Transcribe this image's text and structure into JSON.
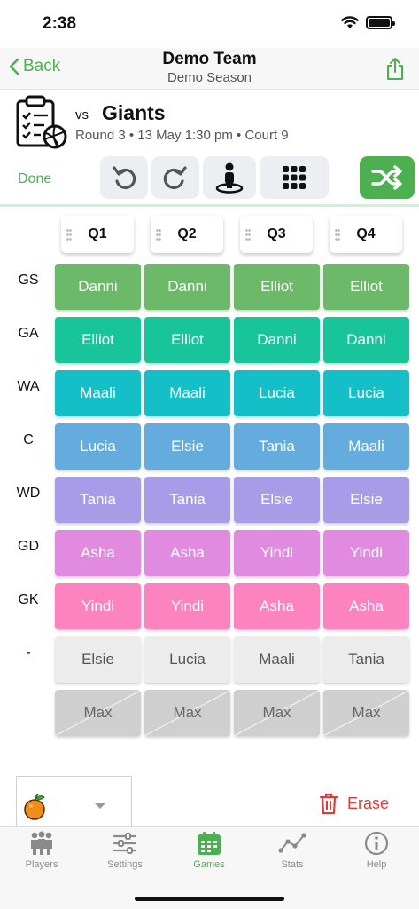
{
  "status_bar": {
    "time": "2:38"
  },
  "nav": {
    "back_label": "Back",
    "title": "Demo Team",
    "subtitle": "Demo Season"
  },
  "game": {
    "vs_label": "vs",
    "opponent": "Giants",
    "details": "Round 3 • 13 May 1:30 pm • Court 9"
  },
  "toolbar": {
    "done_label": "Done"
  },
  "quarters": [
    "Q1",
    "Q2",
    "Q3",
    "Q4"
  ],
  "positions": [
    "GS",
    "GA",
    "WA",
    "C",
    "WD",
    "GD",
    "GK",
    "-"
  ],
  "rows": [
    {
      "color": "#6db96a",
      "players": [
        "Danni",
        "Danni",
        "Elliot",
        "Elliot"
      ]
    },
    {
      "color": "#18c49a",
      "players": [
        "Elliot",
        "Elliot",
        "Danni",
        "Danni"
      ]
    },
    {
      "color": "#14bfc8",
      "players": [
        "Maali",
        "Maali",
        "Lucia",
        "Lucia"
      ]
    },
    {
      "color": "#64acde",
      "players": [
        "Lucia",
        "Elsie",
        "Tania",
        "Maali"
      ]
    },
    {
      "color": "#a89be8",
      "players": [
        "Tania",
        "Tania",
        "Elsie",
        "Elsie"
      ]
    },
    {
      "color": "#e08be0",
      "players": [
        "Asha",
        "Asha",
        "Yindi",
        "Yindi"
      ]
    },
    {
      "color": "#fc82c0",
      "players": [
        "Yindi",
        "Yindi",
        "Asha",
        "Asha"
      ]
    },
    {
      "color": "#ececec",
      "players": [
        "Elsie",
        "Lucia",
        "Maali",
        "Tania"
      ]
    },
    {
      "color": "#cfcfcf",
      "players": [
        "Max",
        "Max",
        "Max",
        "Max"
      ]
    }
  ],
  "bottom": {
    "erase_label": "Erase"
  },
  "tabs": [
    {
      "label": "Players",
      "icon": "players-icon"
    },
    {
      "label": "Settings",
      "icon": "sliders-icon"
    },
    {
      "label": "Games",
      "icon": "calendar-icon"
    },
    {
      "label": "Stats",
      "icon": "chart-icon"
    },
    {
      "label": "Help",
      "icon": "info-icon"
    }
  ],
  "colors": {
    "accent": "#4caf50",
    "erase": "#e53935"
  }
}
